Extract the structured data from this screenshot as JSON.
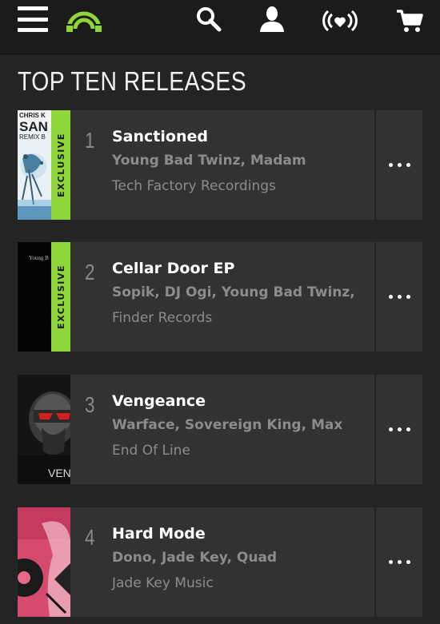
{
  "header": {
    "icons": [
      "menu-icon",
      "logo-icon",
      "search-icon",
      "user-icon",
      "radio-icon",
      "cart-icon"
    ],
    "accent": "#8fd63b"
  },
  "page": {
    "title": "TOP TEN RELEASES"
  },
  "colors": {
    "background": "#242424",
    "card": "#323232",
    "exclusive": "#8fd63b",
    "muted": "#8c8c8c"
  },
  "releases": [
    {
      "rank": "1",
      "title": "Sanctioned",
      "artists": "Young Bad Twinz, Madam",
      "label": "Tech Factory Recordings",
      "exclusive": "EXCLUSIVE",
      "art_text": [
        "CHRIS K",
        "SAN",
        "REMIX B"
      ]
    },
    {
      "rank": "2",
      "title": "Cellar Door EP",
      "artists": "Sopik, DJ Ogi, Young Bad Twinz,",
      "label": "Finder Records",
      "exclusive": "EXCLUSIVE",
      "art_text": [
        "Young B"
      ]
    },
    {
      "rank": "3",
      "title": "Vengeance",
      "artists": "Warface, Sovereign King, Max",
      "label": "End Of Line",
      "art_text": [
        "VENG"
      ]
    },
    {
      "rank": "4",
      "title": "Hard Mode",
      "artists": "Dono, Jade Key, Quad",
      "label": "Jade Key Music"
    }
  ]
}
